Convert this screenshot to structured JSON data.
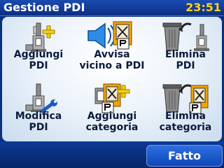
{
  "header": {
    "title": "Gestione PDI",
    "time": "23:51"
  },
  "menu": [
    {
      "label": "Aggiungi\nPDI",
      "icon": "add-poi-icon"
    },
    {
      "label": "Avvisa\nvicino a PDI",
      "icon": "warn-near-poi-icon"
    },
    {
      "label": "Elimina\nPDI",
      "icon": "delete-poi-icon"
    },
    {
      "label": "Modifica\nPDI",
      "icon": "edit-poi-icon"
    },
    {
      "label": "Aggiungi\ncategoria",
      "icon": "add-category-icon"
    },
    {
      "label": "Elimina\ncategoria",
      "icon": "delete-category-icon"
    }
  ],
  "footer": {
    "done_label": "Fatto"
  },
  "colors": {
    "header_bg": "#0b2f83",
    "clock": "#ffd21a",
    "button": "#1d5bd0",
    "plus": "#f5d10f"
  }
}
